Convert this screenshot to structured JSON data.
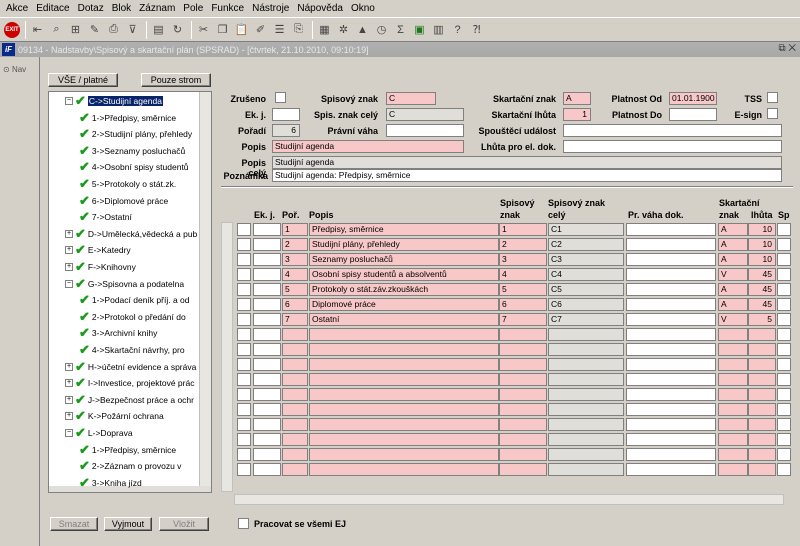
{
  "menu": [
    "Akce",
    "Editace",
    "Dotaz",
    "Blok",
    "Záznam",
    "Pole",
    "Funkce",
    "Nástroje",
    "Nápověda",
    "Okno"
  ],
  "toolbar": {
    "exit_label": "EXIT"
  },
  "window": {
    "title": "09134 - Nadstavby\\Spisový a skartační plán (SPSRAD) - [čtvrtek, 21.10.2010, 09:10:19]"
  },
  "left_nav": {
    "tab": "Nav"
  },
  "buttons": {
    "all_valid": "VŠE / platné",
    "tree_only": "Pouze strom",
    "delete": "Smazat",
    "cut": "Vyjmout",
    "paste": "Vložit"
  },
  "tree": [
    {
      "label": "C->Studijní agenda",
      "level": 0,
      "exp": "−",
      "selected": true
    },
    {
      "label": "1->Předpisy, směrnice",
      "level": 1
    },
    {
      "label": "2->Studijní plány, přehledy",
      "level": 1
    },
    {
      "label": "3->Seznamy posluchačů",
      "level": 1
    },
    {
      "label": "4->Osobní spisy studentů",
      "level": 1
    },
    {
      "label": "5->Protokoly o stát.zk.",
      "level": 1
    },
    {
      "label": "6->Diplomové práce",
      "level": 1
    },
    {
      "label": "7->Ostatní",
      "level": 1
    },
    {
      "label": "D->Umělecká,vědecká a pub",
      "level": 0,
      "exp": "+"
    },
    {
      "label": "E->Katedry",
      "level": 0,
      "exp": "+"
    },
    {
      "label": "F->Knihovny",
      "level": 0,
      "exp": "+"
    },
    {
      "label": "G->Spisovna a podatelna",
      "level": 0,
      "exp": "−"
    },
    {
      "label": "1->Podací deník příj. a od",
      "level": 1
    },
    {
      "label": "2->Protokol o předání do",
      "level": 1
    },
    {
      "label": "3->Archivní knihy",
      "level": 1
    },
    {
      "label": "4->Skartační návrhy, pro",
      "level": 1
    },
    {
      "label": "H->účetní evidence a správa",
      "level": 0,
      "exp": "+"
    },
    {
      "label": "I->Investice, projektové prác",
      "level": 0,
      "exp": "+"
    },
    {
      "label": "J->Bezpečnost práce a ochr",
      "level": 0,
      "exp": "+"
    },
    {
      "label": "K->Požární ochrana",
      "level": 0,
      "exp": "+"
    },
    {
      "label": "L->Doprava",
      "level": 0,
      "exp": "−"
    },
    {
      "label": "1->Předpisy, směrnice",
      "level": 1
    },
    {
      "label": "2->Záznam o provozu v",
      "level": 1
    },
    {
      "label": "3->Kniha jízd",
      "level": 1
    }
  ],
  "form": {
    "zruseno_label": "Zrušeno",
    "spisovy_znak_label": "Spisový znak",
    "spisovy_znak": "C",
    "skartacni_znak_label": "Skartační znak",
    "skartacni_znak": "A",
    "platnost_od_label": "Platnost Od",
    "platnost_od": "01.01.1900",
    "tss_label": "TSS",
    "ekj_label": "Ek. j.",
    "spis_znak_cely_label": "Spis. znak celý",
    "spis_znak_cely": "C",
    "skartacni_lhuta_label": "Skartační lhůta",
    "skartacni_lhuta": "1",
    "platnost_do_label": "Platnost Do",
    "esign_label": "E-sign",
    "poradi_label": "Pořadí",
    "poradi": "6",
    "pravni_vaha_label": "Právní váha",
    "spousteci_udalost_label": "Spouštěcí událost",
    "popis_label": "Popis",
    "popis": "Studijní agenda",
    "lhuta_el_label": "Lhůta pro el. dok.",
    "popis_cely_label": "Popis celý",
    "popis_cely": "Studijní agenda",
    "poznamka_label": "Poznámka",
    "poznamka": "Studijní agenda: Předpisy, směrnice"
  },
  "grid": {
    "headers": {
      "ekj": "Ek. j.",
      "por": "Poř.",
      "popis": "Popis",
      "spis_znak_1": "Spisový",
      "spis_znak_2": "znak",
      "spis_cely_1": "Spisový znak",
      "spis_cely_2": "celý",
      "pr_vaha": "Pr. váha dok.",
      "skart_1": "Skartační",
      "skart_2": "znak",
      "lhuta": "lhůta",
      "sp": "Sp"
    },
    "rows": [
      {
        "por": "1",
        "popis": "Předpisy, směrnice",
        "znak": "1",
        "cely": "C1",
        "skart": "A",
        "lhuta": "10"
      },
      {
        "por": "2",
        "popis": "Studijní plány, přehledy",
        "znak": "2",
        "cely": "C2",
        "skart": "A",
        "lhuta": "10"
      },
      {
        "por": "3",
        "popis": "Seznamy posluchačů",
        "znak": "3",
        "cely": "C3",
        "skart": "A",
        "lhuta": "10"
      },
      {
        "por": "4",
        "popis": "Osobní spisy studentů a absolventů",
        "znak": "4",
        "cely": "C4",
        "skart": "V",
        "lhuta": "45"
      },
      {
        "por": "5",
        "popis": "Protokoly o stát.záv.zkouškách",
        "znak": "5",
        "cely": "C5",
        "skart": "A",
        "lhuta": "45"
      },
      {
        "por": "6",
        "popis": "Diplomové práce",
        "znak": "6",
        "cely": "C6",
        "skart": "A",
        "lhuta": "45"
      },
      {
        "por": "7",
        "popis": "Ostatní",
        "znak": "7",
        "cely": "C7",
        "skart": "V",
        "lhuta": "5"
      }
    ],
    "empty_rows": 10
  },
  "footer": {
    "all_ej_label": "Pracovat se všemi EJ"
  }
}
